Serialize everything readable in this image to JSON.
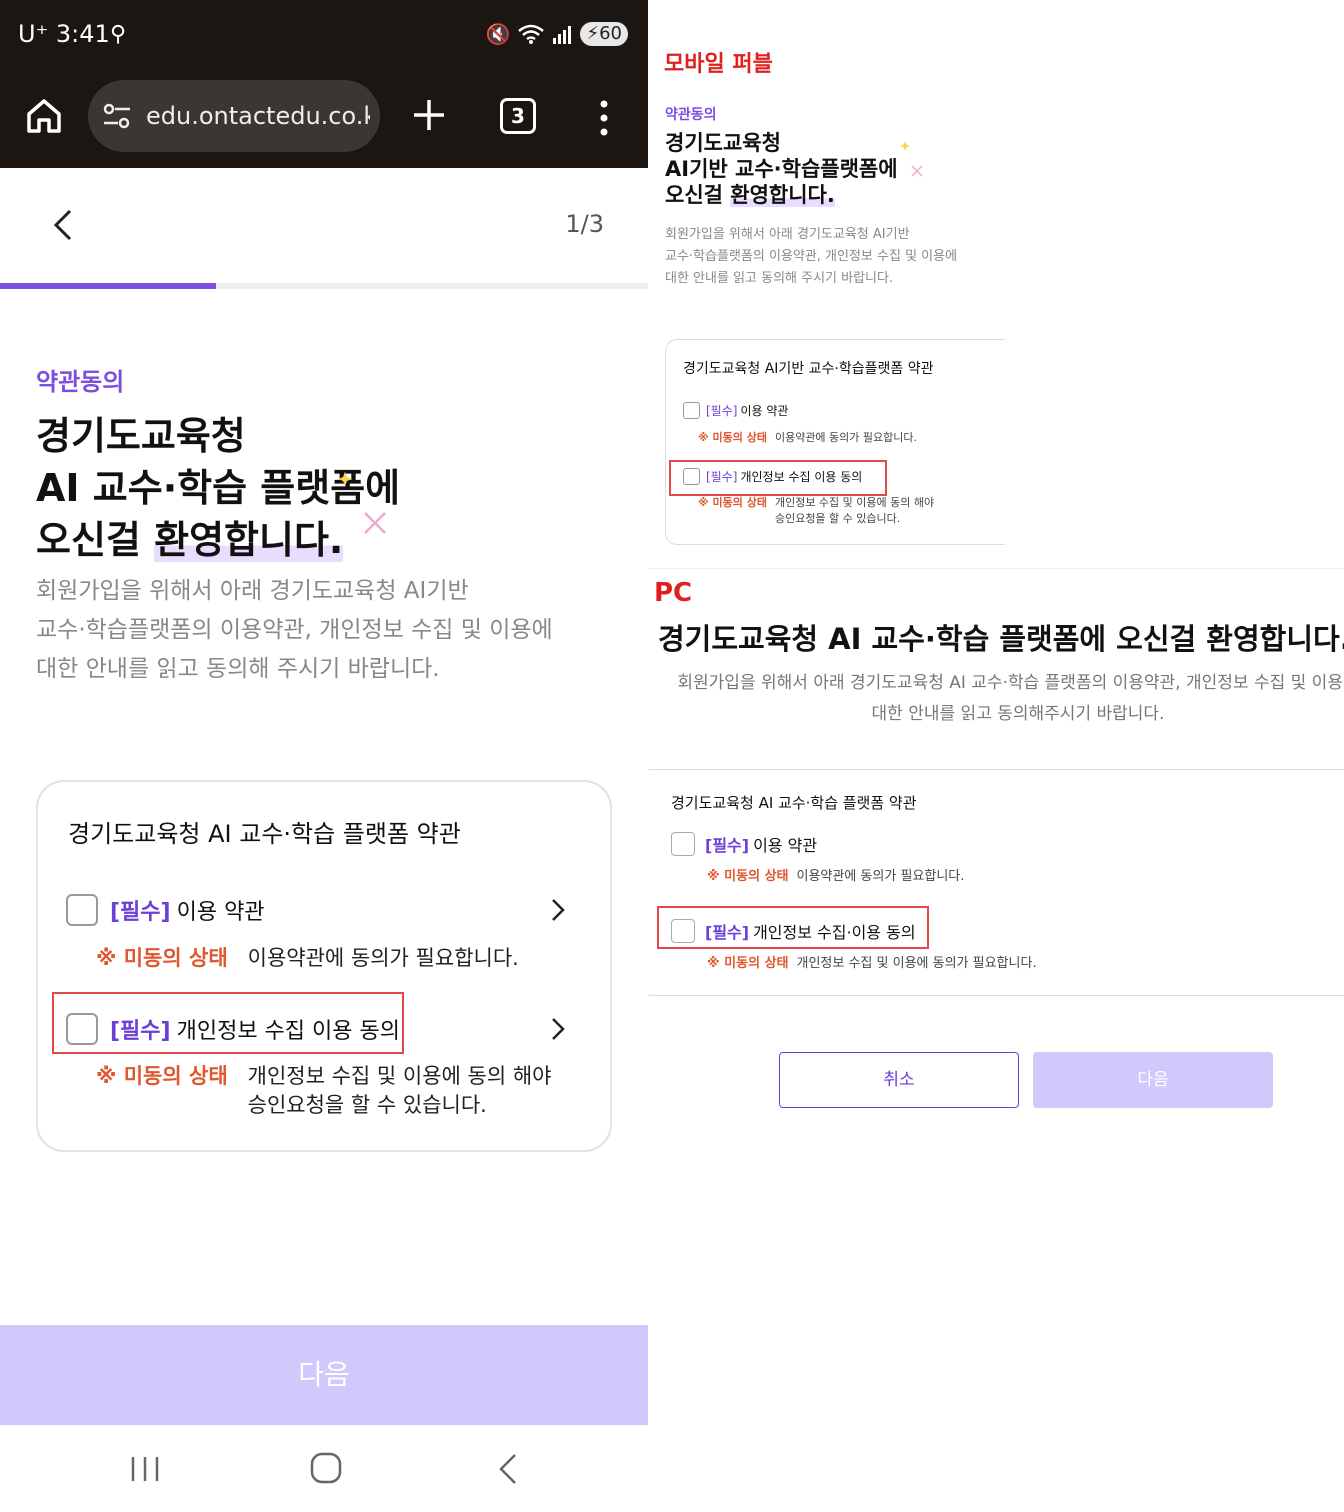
{
  "status_bar": {
    "carrier_time": "U⁺ 3:41",
    "battery": "60"
  },
  "browser": {
    "url": "edu.ontactedu.co.kr",
    "tab_count": "3"
  },
  "mobile": {
    "step": "1/3",
    "progress_fraction": 0.333,
    "kicker": "약관동의",
    "title_line1": "경기도교육청",
    "title_line2": "AI 교수·학습 플랫폼에",
    "title_line3_plain": "오신걸 ",
    "title_line3_highlight": "환영합니다.",
    "description_lines": [
      "회원가입을 위해서 아래 경기도교육청 AI기반",
      "교수·학습플랫폼의 이용약관, 개인정보 수집 및 이용에",
      "대한 안내를 읽고 동의해 주시기 바랍니다."
    ],
    "card_title": "경기도교육청 AI 교수·학습 플랫폼 약관",
    "items": [
      {
        "required": "[필수]",
        "label": "이용 약관",
        "warn": "※ 미동의 상태",
        "message_lines": [
          "이용약관에 동의가 필요합니다."
        ]
      },
      {
        "required": "[필수]",
        "label": "개인정보 수집 이용 동의",
        "warn": "※ 미동의 상태",
        "message_lines": [
          "개인정보 수집 및 이용에 동의 해야",
          "승인요청을 할 수 있습니다."
        ]
      }
    ],
    "next_button": "다음"
  },
  "spec_mobile": {
    "section_label": "모바일 퍼블",
    "kicker": "약관동의",
    "title_line1": "경기도교육청",
    "title_line2": "AI기반 교수·학습플랫폼에",
    "title_line3_plain": "오신걸 ",
    "title_line3_highlight": "환영합니다.",
    "description_lines": [
      "회원가입을 위해서 아래 경기도교육청 AI기반",
      "교수·학습플랫폼의 이용약관, 개인정보 수집 및 이용에",
      "대한 안내를 읽고 동의해 주시기 바랍니다."
    ],
    "card_title": "경기도교육청 AI기반 교수·학습플랫폼 약관",
    "items": [
      {
        "required": "[필수]",
        "label": "이용 약관",
        "warn": "※ 미동의 상태",
        "message_lines": [
          "이용약관에 동의가 필요합니다."
        ]
      },
      {
        "required": "[필수]",
        "label": "개인정보 수집 이용 동의",
        "warn": "※ 미동의 상태",
        "message_lines": [
          "개인정보 수집 및 이용에 동의 해야",
          "승인요청을 할 수 있습니다."
        ]
      }
    ]
  },
  "spec_pc": {
    "section_label": "PC",
    "title": "경기도교육청 AI 교수·학습 플랫폼에 오신걸 환영합니다.",
    "description_lines": [
      "회원가입을 위해서 아래 경기도교육청 AI 교수·학습 플랫폼의 이용약관, 개인정보 수집 및 이용에",
      "대한 안내를 읽고 동의해주시기 바랍니다."
    ],
    "card_title": "경기도교육청 AI 교수·학습 플랫폼 약관",
    "items": [
      {
        "required": "[필수]",
        "label": "이용 약관",
        "warn": "※ 미동의 상태",
        "message": "이용약관에 동의가 필요합니다."
      },
      {
        "required": "[필수]",
        "label": "개인정보 수집·이용 동의",
        "warn": "※ 미동의 상태",
        "message": "개인정보 수집 및 이용에 동의가 필요합니다."
      }
    ],
    "cancel_button": "취소",
    "next_button": "다음"
  },
  "colors": {
    "accent": "#7b4fe0",
    "required_label": "#6c3fd6",
    "warning": "#e0562f",
    "annotation_red": "#e04a4a",
    "disabled_button": "#d2c8fb",
    "browser_chrome": "#1b1612"
  },
  "icons": [
    "home-icon",
    "site-settings-icon",
    "plus-icon",
    "tabs-icon",
    "more-menu-icon",
    "back-chevron-icon",
    "chevron-right-icon",
    "sparkle-icon",
    "cross-decoration-icon",
    "recent-apps-icon",
    "home-nav-icon",
    "back-nav-icon"
  ]
}
